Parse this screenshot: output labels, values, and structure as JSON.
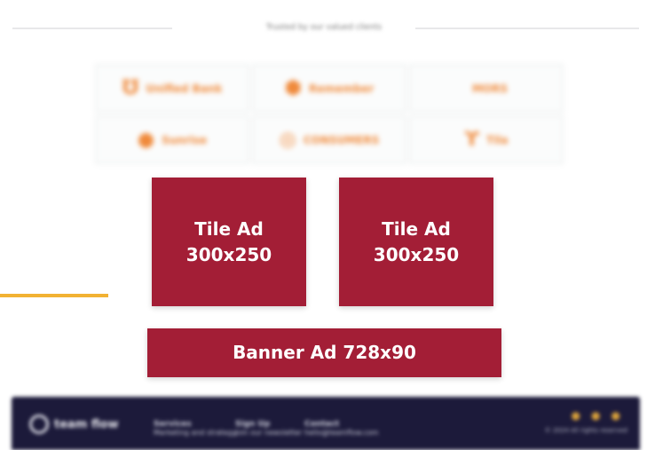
{
  "header": {
    "caption": "Trusted by our valued clients"
  },
  "partner_logos": [
    {
      "name": "Unified Bank",
      "icon": "u-logo-icon"
    },
    {
      "name": "Remember",
      "icon": "r-logo-icon"
    },
    {
      "name": "MORS",
      "icon": "wordmark-icon"
    },
    {
      "name": "Sunrise",
      "icon": "sun-logo-icon"
    },
    {
      "name": "CONSUMERS",
      "icon": "c-logo-icon"
    },
    {
      "name": "Tila",
      "icon": "script-logo-icon"
    }
  ],
  "ads": {
    "tile_1": "Tile Ad\n300x250",
    "tile_2": "Tile Ad\n300x250",
    "banner": "Banner Ad 728x90"
  },
  "footer": {
    "logo_text": "team flow",
    "columns": [
      {
        "title": "Services",
        "sub": "Marketing and strategy"
      },
      {
        "title": "Sign Up",
        "sub": "Join our newsletter"
      },
      {
        "title": "Contact",
        "sub": "hello@teamflow.com"
      }
    ],
    "social_icons": [
      "facebook-icon",
      "twitter-icon",
      "linkedin-icon"
    ],
    "copyright": "© 2024 All rights reserved"
  },
  "colors": {
    "ad_background": "#a31e36",
    "accent": "#f2b233",
    "footer_background": "#1c1a3a",
    "logo_orange": "#f08a3b"
  }
}
